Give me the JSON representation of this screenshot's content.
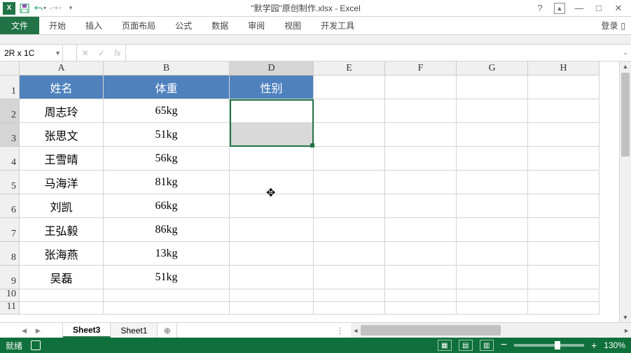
{
  "title": "\"默学园\"原创制作.xlsx - Excel",
  "qat": {
    "save": "save",
    "undo": "undo",
    "redo": "redo"
  },
  "window": {
    "help": "?",
    "ribbon_opts": "▭",
    "min": "—",
    "max": "□",
    "close": "✕"
  },
  "tabs": {
    "file": "文件",
    "items": [
      "开始",
      "插入",
      "页面布局",
      "公式",
      "数据",
      "审阅",
      "视图",
      "开发工具"
    ],
    "signin": "登录"
  },
  "namebox": "2R x 1C",
  "fx": {
    "cancel": "✕",
    "enter": "✓",
    "label": "fx",
    "value": ""
  },
  "cols": [
    "A",
    "B",
    "D",
    "E",
    "F",
    "G",
    "H"
  ],
  "colWidths": {
    "A": 120,
    "B": 180,
    "D": 120,
    "other": 102
  },
  "headerRow": [
    "姓名",
    "体重",
    "性别"
  ],
  "dataRows": [
    [
      "周志玲",
      "65kg",
      ""
    ],
    [
      "张思文",
      "51kg",
      ""
    ],
    [
      "王雪晴",
      "56kg",
      ""
    ],
    [
      "马海洋",
      "81kg",
      ""
    ],
    [
      "刘凯",
      "66kg",
      ""
    ],
    [
      "王弘毅",
      "86kg",
      ""
    ],
    [
      "张海燕",
      "13kg",
      ""
    ],
    [
      "吴磊",
      "51kg",
      ""
    ]
  ],
  "rowNums": [
    1,
    2,
    3,
    4,
    5,
    6,
    7,
    8,
    9,
    10,
    11
  ],
  "selection": {
    "col": "D",
    "rows": [
      2,
      3
    ],
    "active": "D2"
  },
  "sheets": {
    "active": "Sheet3",
    "others": [
      "Sheet1"
    ]
  },
  "status": {
    "mode": "就绪",
    "macro": "▣",
    "zoom": "130%",
    "minus": "−",
    "plus": "+"
  }
}
